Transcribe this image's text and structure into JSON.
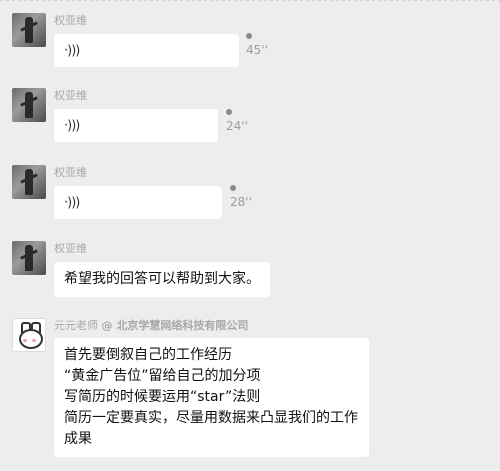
{
  "messages": [
    {
      "sender": "权亚维",
      "type": "voice",
      "duration": "45''"
    },
    {
      "sender": "权亚维",
      "type": "voice",
      "duration": "24''"
    },
    {
      "sender": "权亚维",
      "type": "voice",
      "duration": "28''"
    },
    {
      "sender": "权亚维",
      "type": "text",
      "text": "希望我的回答可以帮助到大家。"
    },
    {
      "sender": "元元老师",
      "org": "@ 北京学慧网络科技有限公司",
      "type": "text",
      "lines": [
        "首先要倒叙自己的工作经历",
        "“黄金广告位”留给自己的加分项",
        "写简历的时候要运用“star”法则",
        "简历一定要真实，尽量用数据来凸显我们的工作",
        "成果"
      ]
    }
  ],
  "icons": {
    "voice": "voice-wave-icon",
    "unread": "unread-dot-icon"
  }
}
